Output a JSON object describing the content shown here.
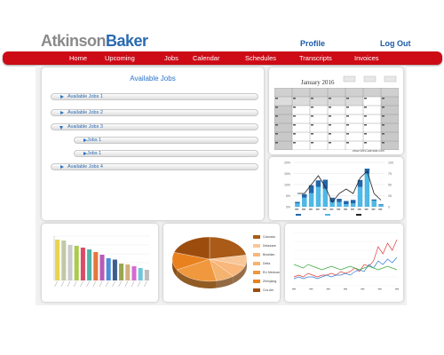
{
  "header": {
    "logo_part1": "Atkinson",
    "logo_part2": "Baker",
    "profile_label": "Profile",
    "logout_label": "Log Out"
  },
  "nav": {
    "items": [
      "Home",
      "Upcoming",
      "Jobs",
      "Calendar",
      "Schedules",
      "Transcripts",
      "Invoices"
    ]
  },
  "jobs_panel": {
    "title": "Available Jobs",
    "rows": [
      {
        "label": "Available Jobs 1",
        "expanded": false,
        "level": 0
      },
      {
        "label": "Available Jobs 2",
        "expanded": false,
        "level": 0
      },
      {
        "label": "Available Jobs 3",
        "expanded": true,
        "level": 0
      },
      {
        "label": "Jobs 1",
        "expanded": false,
        "level": 1
      },
      {
        "label": "Jobs 1",
        "expanded": false,
        "level": 1
      },
      {
        "label": "Available Jobs 4",
        "expanded": false,
        "level": 0
      }
    ]
  },
  "calendar": {
    "title": "January  2016",
    "footer": "www.WinCalendar.com"
  },
  "combo_chart": {
    "y_ticks_left": [
      "20%",
      "15%",
      "10%",
      "5%",
      "0%"
    ],
    "y_ticks_right": [
      "100",
      "75",
      "50",
      "25",
      "0"
    ],
    "dark_bars": [
      0.6,
      1.6,
      3.6,
      2.9,
      4.1,
      1.9,
      1.5,
      1.4,
      1.6,
      3.2,
      2.2,
      0.5,
      0.3
    ],
    "light_bars": [
      1.6,
      4.1,
      6.1,
      9.0,
      8.1,
      2.2,
      2.1,
      1.2,
      1.5,
      8.9,
      15.0,
      2.8,
      0.8
    ],
    "line": [
      6,
      6,
      10,
      14,
      9,
      2,
      6,
      8,
      6,
      13,
      16,
      6,
      3
    ],
    "legend": [
      "",
      "",
      ""
    ],
    "colors": {
      "dark": "#2266aa",
      "light": "#4fb8e6",
      "line": "#222222"
    }
  },
  "bar_chart": {
    "title": "",
    "values": [
      92,
      90,
      80,
      78,
      74,
      70,
      64,
      58,
      50,
      47,
      38,
      36,
      32,
      28,
      24
    ],
    "colors": [
      "#e8d44f",
      "#c0c9a4",
      "#cbcbcb",
      "#a9cc4c",
      "#d94b66",
      "#4fb5a8",
      "#e5763f",
      "#b85ab8",
      "#4b8ed9",
      "#3d5d8f",
      "#9aa64f",
      "#cfb07e",
      "#d46ad4",
      "#6ec6d9",
      "#bdbdbd"
    ]
  },
  "pie_chart": {
    "slices": [
      {
        "name": "",
        "value": 22,
        "color": "#a95b17"
      },
      {
        "name": "",
        "value": 8,
        "color": "#f7c79a"
      },
      {
        "name": "",
        "value": 9,
        "color": "#f9b77b"
      },
      {
        "name": "",
        "value": 8,
        "color": "#f5b370"
      },
      {
        "name": "",
        "value": 20,
        "color": "#f0983d"
      },
      {
        "name": "",
        "value": 13,
        "color": "#e9821e"
      },
      {
        "name": "",
        "value": 20,
        "color": "#9c4d0e"
      }
    ],
    "legend": [
      "Colorado",
      "Delaware",
      "Brazilian",
      "Delta",
      "EU Mexicans",
      "Zhenjiang",
      "Cos Am"
    ]
  },
  "line_chart": {
    "series": [
      {
        "color": "#e03a3a",
        "values": [
          5,
          6,
          5,
          7,
          6,
          5,
          6,
          6,
          7,
          6,
          8,
          7,
          8,
          10,
          8,
          12,
          11,
          14,
          22,
          18,
          24,
          20,
          26
        ]
      },
      {
        "color": "#2f7fd3",
        "values": [
          4,
          5,
          4,
          5,
          5,
          4,
          5,
          6,
          5,
          6,
          6,
          7,
          6,
          8,
          9,
          8,
          12,
          10,
          14,
          12,
          15,
          13,
          16
        ]
      },
      {
        "color": "#3faa3f",
        "values": [
          12,
          11,
          10,
          12,
          11,
          10,
          9,
          10,
          11,
          10,
          9,
          10,
          11,
          10,
          9,
          10,
          11,
          10,
          9,
          10,
          11,
          10,
          9
        ]
      }
    ]
  }
}
